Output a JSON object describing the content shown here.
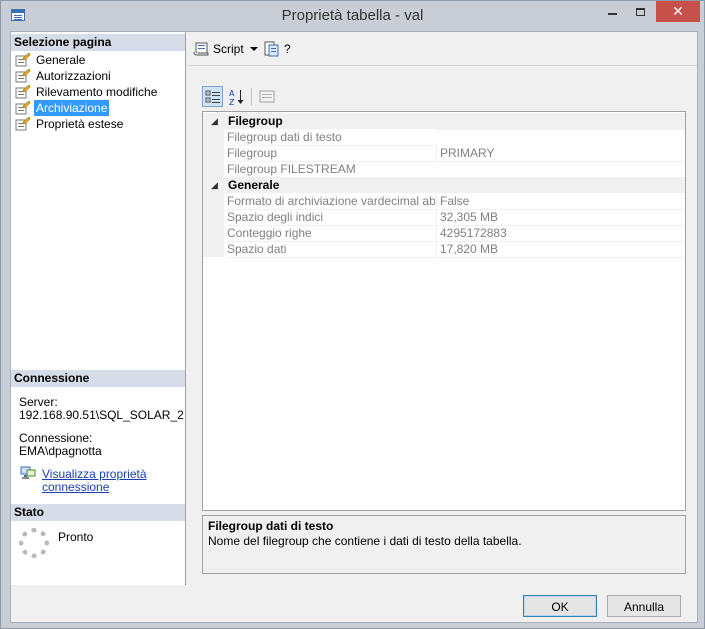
{
  "window": {
    "title": "Proprietà tabella - val",
    "close_glyph": "✕"
  },
  "select_page": {
    "header": "Selezione pagina",
    "items": [
      {
        "label": "Generale",
        "icon": "property-page-icon",
        "selected": false
      },
      {
        "label": "Autorizzazioni",
        "icon": "property-page-icon",
        "selected": false
      },
      {
        "label": "Rilevamento modifiche",
        "icon": "property-page-icon",
        "selected": false
      },
      {
        "label": "Archiviazione",
        "icon": "property-page-icon",
        "selected": true
      },
      {
        "label": "Proprietà estese",
        "icon": "property-page-icon",
        "selected": false
      }
    ]
  },
  "connection": {
    "header": "Connessione",
    "server_label": "Server:",
    "server_value": "192.168.90.51\\SQL_SOLAR_2",
    "connection_label": "Connessione:",
    "connection_value": "EMA\\dpagnotta",
    "view_link_line1": "Visualizza proprietà",
    "view_link_line2": "connessione"
  },
  "status": {
    "header": "Stato",
    "text": "Pronto"
  },
  "toolbar": {
    "script_label": "Script",
    "help_label": "?"
  },
  "grid": {
    "categories": [
      {
        "name": "Filegroup",
        "rows": [
          {
            "name": "Filegroup dati di testo",
            "value": ""
          },
          {
            "name": "Filegroup",
            "value": "PRIMARY"
          },
          {
            "name": "Filegroup FILESTREAM",
            "value": ""
          }
        ]
      },
      {
        "name": "Generale",
        "rows": [
          {
            "name": "Formato di archiviazione vardecimal abilitato",
            "value": "False"
          },
          {
            "name": "Spazio degli indici",
            "value": "32,305 MB"
          },
          {
            "name": "Conteggio righe",
            "value": "4295172883"
          },
          {
            "name": "Spazio dati",
            "value": "17,820 MB"
          }
        ]
      }
    ]
  },
  "description": {
    "title": "Filegroup dati di testo",
    "text": "Nome del filegroup che contiene i dati di testo della tabella."
  },
  "buttons": {
    "ok": "OK",
    "cancel": "Annulla"
  }
}
